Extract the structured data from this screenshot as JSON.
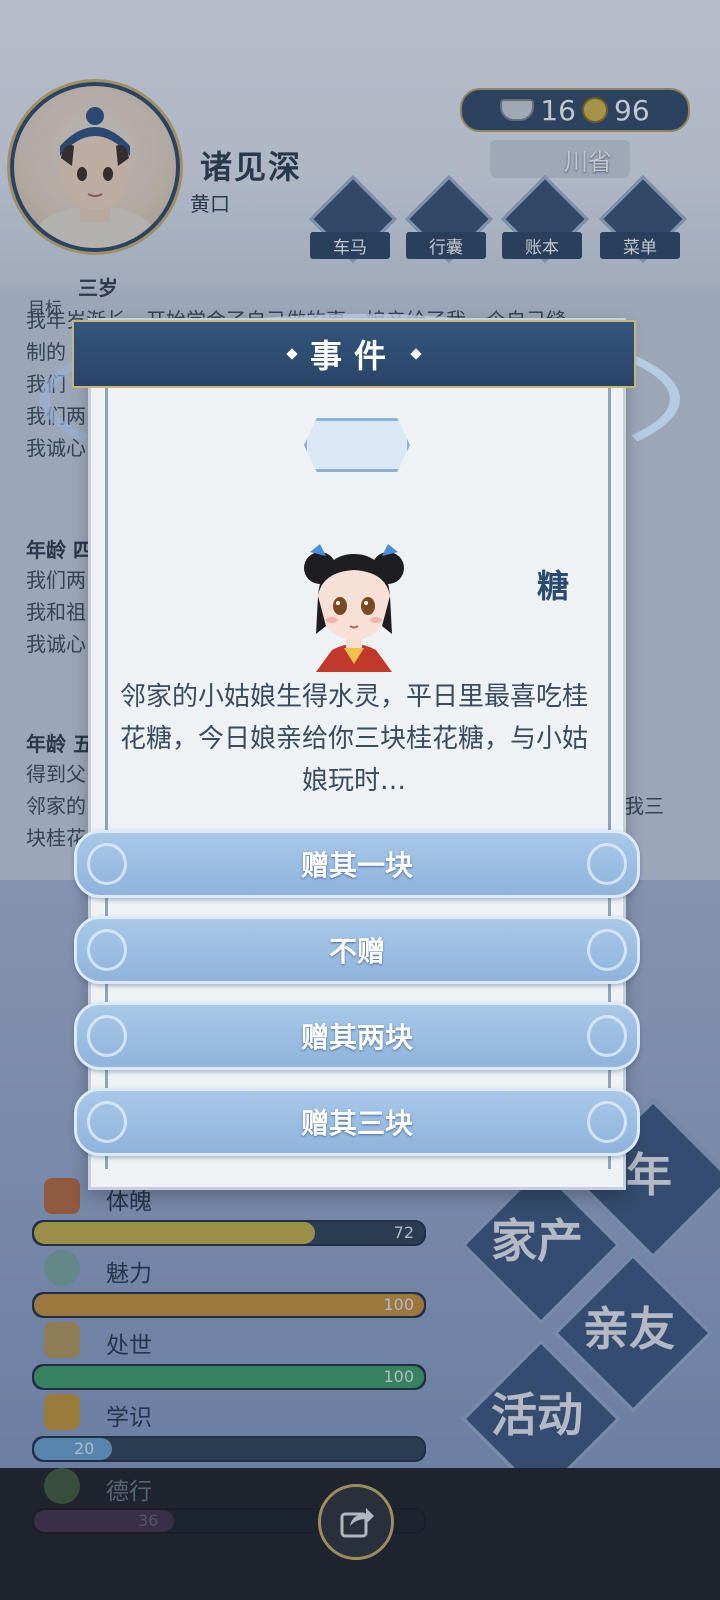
{
  "player": {
    "name": "诸见深",
    "title": "黄口"
  },
  "currency": {
    "silver": "16",
    "copper": "96"
  },
  "location": "川省",
  "nav": [
    {
      "label": "车马"
    },
    {
      "label": "行囊"
    },
    {
      "label": "账本"
    },
    {
      "label": "菜单"
    }
  ],
  "goal_label": "目标",
  "log": {
    "age3_head": "三岁",
    "age3_lines": [
      "我年岁渐长，开始学会了自己做的事，娘亲给了我一个自己缝",
      "制的",
      "我们",
      "我们两",
      "我诚心"
    ],
    "age4_head": "年龄 四",
    "age4_lines": [
      "我们两",
      "我和祖",
      "我诚心"
    ],
    "age5_head": "年龄 五",
    "age5_lines": [
      "得到父",
      "邻家的",
      "块桂花"
    ],
    "right_fragment": "我三"
  },
  "stats": [
    {
      "label": "体魄",
      "value": 72,
      "max": 100,
      "display": "72",
      "color": "#c9b34d"
    },
    {
      "label": "魅力",
      "value": 100,
      "max": 100,
      "display": "100",
      "color": "#c9933d"
    },
    {
      "label": "处世",
      "value": 100,
      "max": 100,
      "display": "100",
      "color": "#3ea36b"
    },
    {
      "label": "学识",
      "value": 20,
      "max": 100,
      "display": "20",
      "color": "#6aa6d6"
    },
    {
      "label": "德行",
      "value": 36,
      "max": 100,
      "display": "36",
      "color": "#8a4a8e"
    }
  ],
  "big_buttons": [
    "年",
    "家产",
    "亲友",
    "活动"
  ],
  "modal": {
    "header": "事件",
    "event_name": "糖",
    "description": "邻家的小姑娘生得水灵，平日里最喜吃桂花糖，今日娘亲给你三块桂花糖，与小姑娘玩时…",
    "choices": [
      "赠其一块",
      "不赠",
      "赠其两块",
      "赠其三块"
    ]
  },
  "colors": {
    "accent": "#2a4468",
    "gold_trim": "#c8b676",
    "choice_fill": "#9fc0e2"
  }
}
